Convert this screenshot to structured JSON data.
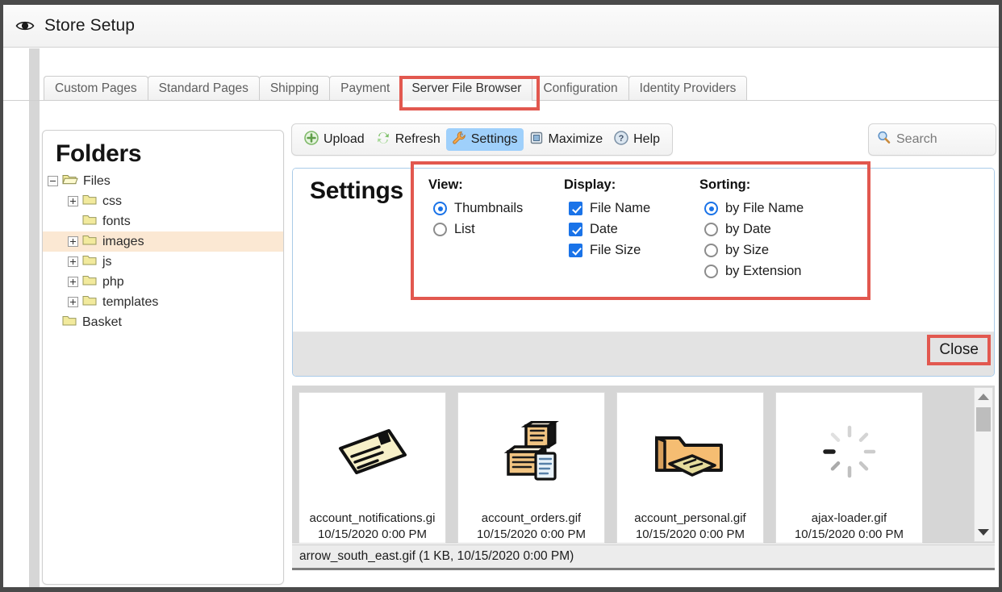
{
  "window": {
    "title": "Store Setup",
    "title_icon": "eye-icon"
  },
  "tabs": [
    {
      "label": "Custom Pages",
      "active": false
    },
    {
      "label": "Standard Pages",
      "active": false
    },
    {
      "label": "Shipping",
      "active": false
    },
    {
      "label": "Payment",
      "active": false
    },
    {
      "label": "Server File Browser",
      "active": true
    },
    {
      "label": "Configuration",
      "active": false
    },
    {
      "label": "Identity Providers",
      "active": false
    }
  ],
  "folders_panel": {
    "title": "Folders",
    "tree": [
      {
        "label": "Files",
        "depth": 0,
        "expander": "minus",
        "selected": false,
        "open": true
      },
      {
        "label": "css",
        "depth": 1,
        "expander": "plus",
        "selected": false,
        "open": false
      },
      {
        "label": "fonts",
        "depth": 1,
        "expander": "none",
        "selected": false,
        "open": false
      },
      {
        "label": "images",
        "depth": 1,
        "expander": "plus",
        "selected": true,
        "open": false
      },
      {
        "label": "js",
        "depth": 1,
        "expander": "plus",
        "selected": false,
        "open": false
      },
      {
        "label": "php",
        "depth": 1,
        "expander": "plus",
        "selected": false,
        "open": false
      },
      {
        "label": "templates",
        "depth": 1,
        "expander": "plus",
        "selected": false,
        "open": false
      },
      {
        "label": "Basket",
        "depth": 0,
        "expander": "none",
        "selected": false,
        "open": false
      }
    ]
  },
  "toolbar": {
    "items": [
      {
        "label": "Upload",
        "icon": "upload-plus-icon",
        "active": false
      },
      {
        "label": "Refresh",
        "icon": "refresh-icon",
        "active": false
      },
      {
        "label": "Settings",
        "icon": "wrench-icon",
        "active": true
      },
      {
        "label": "Maximize",
        "icon": "maximize-icon",
        "active": false
      },
      {
        "label": "Help",
        "icon": "help-question-icon",
        "active": false
      }
    ]
  },
  "search": {
    "placeholder": "Search",
    "value": "",
    "icon": "search-magnifier-icon"
  },
  "settings_dialog": {
    "heading": "Settings",
    "close_label": "Close",
    "groups": [
      {
        "name": "view",
        "title": "View:",
        "control": "radio",
        "options": [
          {
            "label": "Thumbnails",
            "checked": true
          },
          {
            "label": "List",
            "checked": false
          }
        ]
      },
      {
        "name": "display",
        "title": "Display:",
        "control": "checkbox",
        "options": [
          {
            "label": "File Name",
            "checked": true
          },
          {
            "label": "Date",
            "checked": true
          },
          {
            "label": "File Size",
            "checked": true
          }
        ]
      },
      {
        "name": "sorting",
        "title": "Sorting:",
        "control": "radio",
        "options": [
          {
            "label": "by File Name",
            "checked": true
          },
          {
            "label": "by Date",
            "checked": false
          },
          {
            "label": "by Size",
            "checked": false
          },
          {
            "label": "by Extension",
            "checked": false
          }
        ]
      }
    ]
  },
  "thumbnails": [
    {
      "name": "account_notifications.gi",
      "date": "10/15/2020 0:00 PM",
      "icon": "envelope-letter-icon"
    },
    {
      "name": "account_orders.gif",
      "date": "10/15/2020 0:00 PM",
      "icon": "boxes-clipboard-icon"
    },
    {
      "name": "account_personal.gif",
      "date": "10/15/2020 0:00 PM",
      "icon": "folder-book-icon"
    },
    {
      "name": "ajax-loader.gif",
      "date": "10/15/2020 0:00 PM",
      "icon": "spinner-icon"
    }
  ],
  "statusbar": {
    "text": "arrow_south_east.gif (1 KB, 10/15/2020 0:00 PM)"
  },
  "annotations": {
    "highlight_color": "#e2584f",
    "boxes": [
      "server-file-browser-tab",
      "settings-options-group",
      "close-button"
    ]
  },
  "colors": {
    "accent_blue": "#1a73e8",
    "toolbar_active": "#9fd0fb",
    "tree_selection": "#fbe8d3",
    "highlight_red": "#e2584f"
  }
}
